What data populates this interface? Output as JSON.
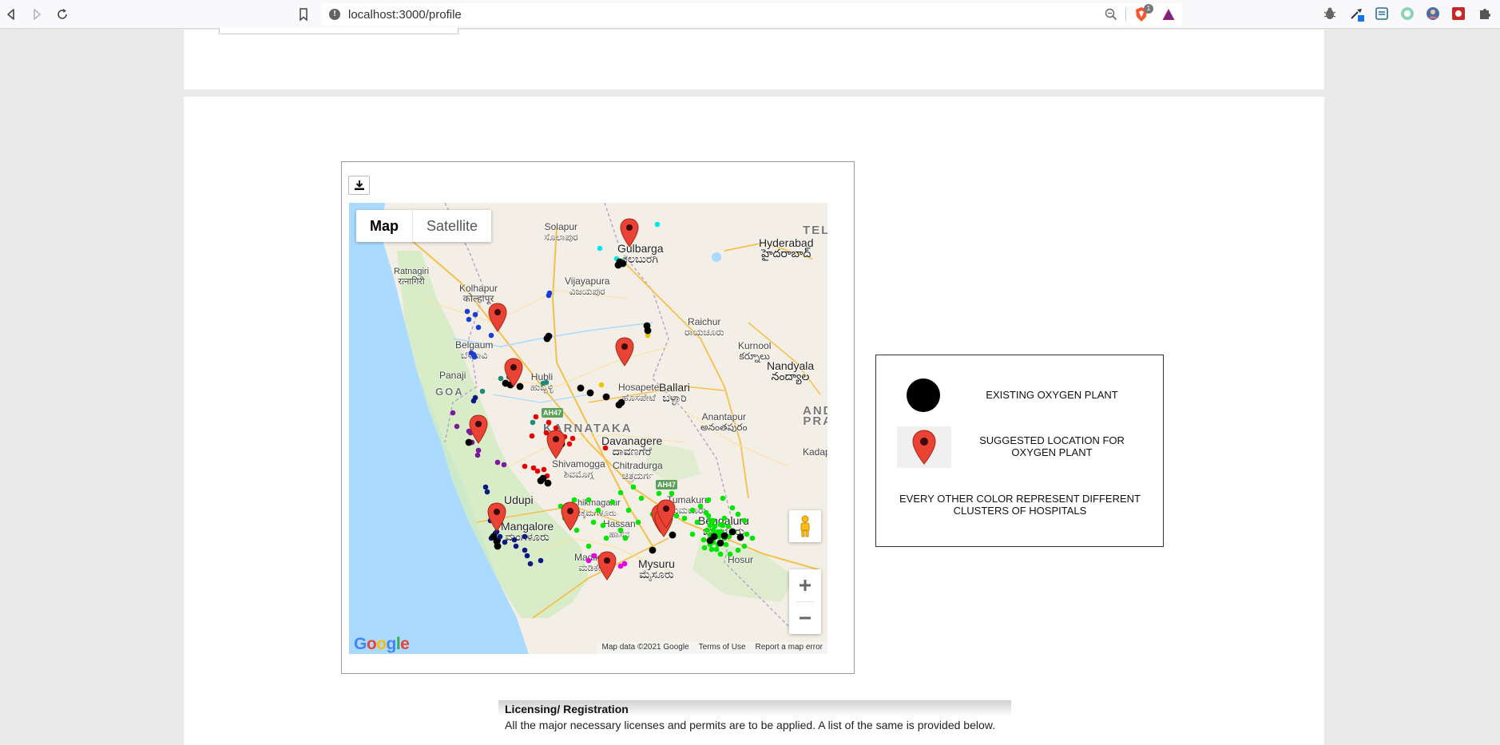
{
  "browser": {
    "url": "localhost:3000/profile",
    "shield_count": "1"
  },
  "map": {
    "type_map": "Map",
    "type_satellite": "Satellite",
    "google_logo": "Google",
    "attribution": {
      "map_data": "Map data ©2021 Google",
      "terms": "Terms of Use",
      "report": "Report a map error"
    },
    "labels": {
      "solapur": "Solapur",
      "solapur_kn": "ಸೊಲಾಪುರ",
      "gulbarga": "Gulbarga",
      "gulbarga_kn": "ಕಲಬುರಗಿ",
      "hyderabad": "Hyderabad",
      "hyderabad_te": "హైదరాబాద్",
      "tel": "TEL",
      "ratnagiri": "Ratnagiri",
      "ratnagiri_mr": "रत्नागिरी",
      "kolhapur": "Kolhapur",
      "kolhapur_mr": "कोल्हापूर",
      "vijayapura": "Vijayapura",
      "vijayapura_kn": "ವಿಜಯಪುರ",
      "raichur": "Raichur",
      "raichur_kn": "ರಾಯಚೂರು",
      "kurnool": "Kurnool",
      "kurnool_te": "కర్నూలు",
      "belgaum": "Belgaum",
      "belgaum_kn": "ಬೆಳಗಾವಿ",
      "nandyala": "Nandyala",
      "nandyala_te": "నంద్యాల",
      "panaji": "Panaji",
      "goa": "GOA",
      "hosapete": "Hosapete",
      "hosapete_kn": "ಹೊಸಪೇಟೆ",
      "ballari": "Ballari",
      "ballari_kn": "ಬಳ್ಳಾರಿ",
      "and": "AND",
      "pra": "PRA",
      "anantapur": "Anantapur",
      "anantapur_te": "అనంతపురం",
      "karnataka": "KARNATAKA",
      "davanagere": "Davanagere",
      "davanagere_kn": "ದಾವಣಗೆರೆ",
      "kadapa": "Kadapa",
      "shivamogga": "Shivamogga",
      "shivamogga_kn": "ಶಿವಮೊಗ್ಗ",
      "chitradurga": "Chitradurga",
      "chitradurga_kn": "ಚಿತ್ರದುರ್ಗ",
      "tumakuru": "Tumakuru",
      "tumakuru_kn": "ತುಮಕೂರು",
      "udupi": "Udupi",
      "chikmagalur": "Chikmagalur",
      "chikmagalur_kn": "ಚಿಕ್ಕಮಗಳೂರು",
      "bengaluru": "Bengaluru",
      "bengaluru_kn": "ಬೆಂಗಳೂರು",
      "hassan": "Hassan",
      "hassan_kn": "ಹಾಸನ",
      "mangalore": "Mangalore",
      "mangalore_kn": "ಮಂಗಳೂರು",
      "hosur": "Hosur",
      "madikeri": "Madikeri",
      "madikeri_kn": "ಮಡಿಕೇರಿ",
      "mysuru": "Mysuru",
      "mysuru_kn": "ಮೈಸೂರು",
      "hubli": "Hubli",
      "hubli_kn": "ಹುಬ್ಬಳ್ಳಿ",
      "ah47": "AH47"
    },
    "suggested_pin_count": 12,
    "colors": {
      "pin": "#ea4335",
      "existing_plant": "#000000",
      "clusters": [
        "#1a3fd6",
        "#0a1a80",
        "#00e6e6",
        "#1f8a7a",
        "#00e600",
        "#e60000",
        "#7a1a9a",
        "#e600e6",
        "#e6c800"
      ]
    }
  },
  "legend": {
    "existing": "EXISTING OXYGEN PLANT",
    "suggested": "SUGGESTED LOCATION FOR OXYGEN PLANT",
    "clusters": "EVERY OTHER COLOR REPRESENT DIFFERENT CLUSTERS OF HOSPITALS"
  },
  "licensing": {
    "title": "Licensing/ Registration",
    "text": "All the major necessary licenses and permits are to be applied. A list of the same is provided below."
  }
}
